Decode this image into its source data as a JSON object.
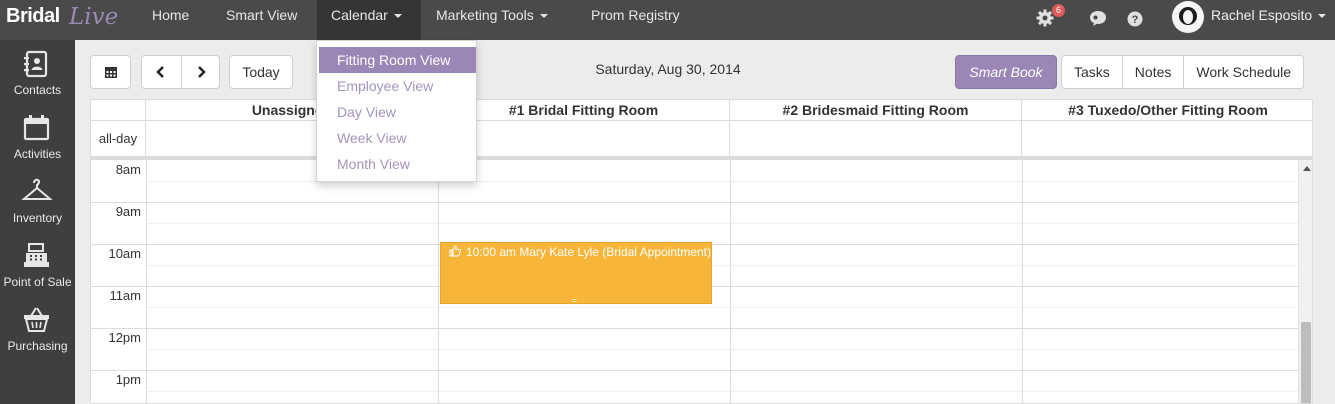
{
  "app": {
    "logo_part1": "Bridal",
    "logo_part2": "Live"
  },
  "nav": {
    "items": [
      {
        "label": "Home"
      },
      {
        "label": "Smart View"
      },
      {
        "label": "Calendar"
      },
      {
        "label": "Marketing Tools"
      },
      {
        "label": "Prom Registry"
      }
    ],
    "notification_count": "6",
    "user_name": "Rachel Esposito"
  },
  "sidebar": {
    "items": [
      {
        "label": "Contacts",
        "icon": "contacts-icon"
      },
      {
        "label": "Activities",
        "icon": "calendar-icon"
      },
      {
        "label": "Inventory",
        "icon": "hanger-icon"
      },
      {
        "label": "Point of Sale",
        "icon": "register-icon"
      },
      {
        "label": "Purchasing",
        "icon": "basket-icon"
      }
    ]
  },
  "toolbar": {
    "today_label": "Today",
    "date_title": "Saturday, Aug 30, 2014",
    "smart_book_label": "Smart Book",
    "tasks_label": "Tasks",
    "notes_label": "Notes",
    "work_schedule_label": "Work Schedule"
  },
  "calendar": {
    "columns": [
      {
        "label": "Unassigned"
      },
      {
        "label": "#1 Bridal Fitting Room"
      },
      {
        "label": "#2 Bridesmaid Fitting Room"
      },
      {
        "label": "#3 Tuxedo/Other Fitting Room"
      }
    ],
    "allday_label": "all-day",
    "times": [
      "8am",
      "9am",
      "10am",
      "11am",
      "12pm",
      "1pm"
    ],
    "event": {
      "text": "10:00 am Mary Kate Lyle (Bridal Appointment)",
      "color": "#f7b63a"
    }
  },
  "calendar_menu": {
    "items": [
      {
        "label": "Fitting Room View",
        "active": true
      },
      {
        "label": "Employee View"
      },
      {
        "label": "Day View"
      },
      {
        "label": "Week View"
      },
      {
        "label": "Month View"
      }
    ]
  },
  "colors": {
    "accent": "#9a87b6",
    "event": "#f7b63a",
    "navbar": "#4a4a4a",
    "sidebar": "#3f3f3f"
  }
}
